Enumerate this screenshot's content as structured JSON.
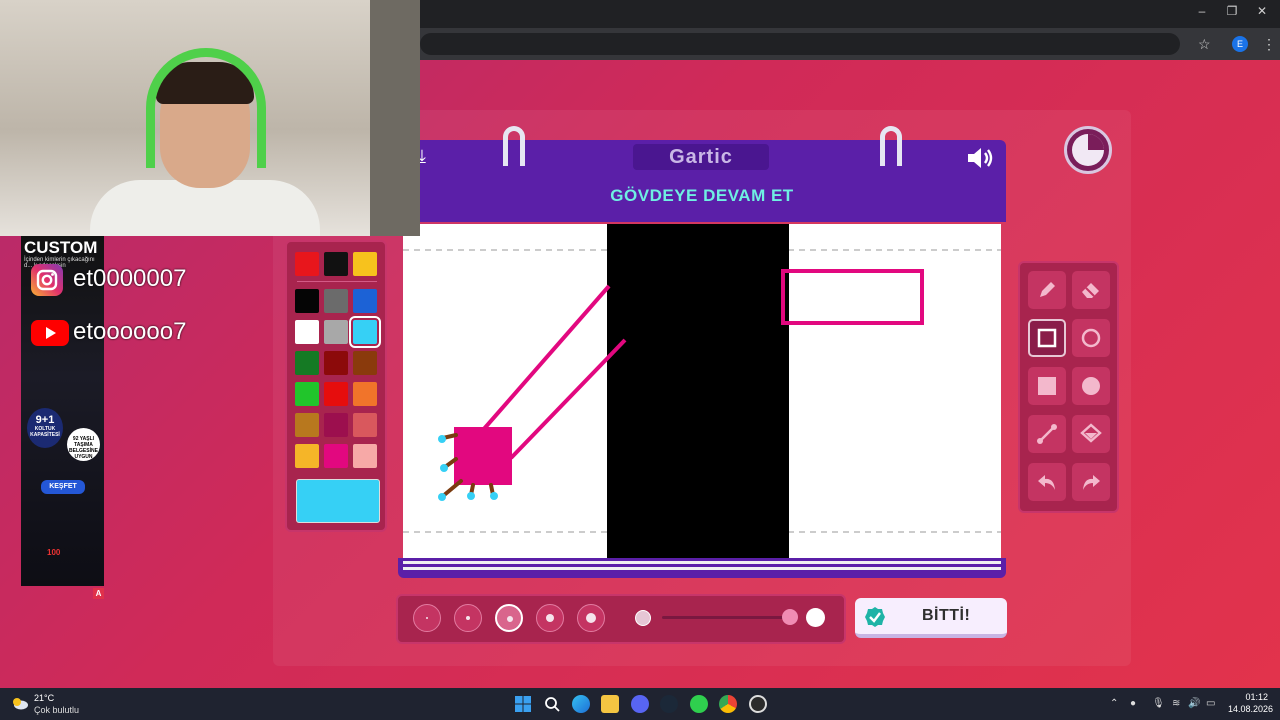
{
  "game": {
    "logo": "Gartic",
    "prompt": "GÖVDEYE DEVAM ET",
    "finish_label": "BİTTİ!"
  },
  "overlay": {
    "instagram": "et0000007",
    "youtube": "etoooooo7"
  },
  "ad": {
    "title": "CUSTOM",
    "subtitle": "İçinden kimlerin çıkacağını d... k edeceksin",
    "badge_line1": "9+1",
    "badge_line2": "KOLTUK KAPASİTESİ",
    "badge2_text": "92 YAŞLI TAŞIMA BELGESİNE UYGUN",
    "cta": "KEŞFET",
    "brand": "100",
    "mark": "A"
  },
  "palette": {
    "colors": [
      "#e8161c",
      "#111111",
      "#f7c21d",
      "#050505",
      "#6b6b6b",
      "#1c62d6",
      "#ffffff",
      "#a8a8a8",
      "#36d0f5",
      "#157a24",
      "#8c0a0a",
      "#8a3a0c",
      "#21c52b",
      "#e60d0d",
      "#f1742a",
      "#b8781e",
      "#9c0f4e",
      "#d9585d",
      "#f5b528",
      "#e2087f",
      "#f7a9a7"
    ],
    "selected_index": 8,
    "selected_color": "#36d0f5"
  },
  "tools": [
    {
      "name": "pencil",
      "selected": false
    },
    {
      "name": "eraser",
      "selected": false
    },
    {
      "name": "rectangle-outline",
      "selected": true
    },
    {
      "name": "circle-outline",
      "selected": false
    },
    {
      "name": "rectangle-filled",
      "selected": false
    },
    {
      "name": "circle-filled",
      "selected": false
    },
    {
      "name": "line",
      "selected": false
    },
    {
      "name": "fill-bucket",
      "selected": false
    },
    {
      "name": "undo",
      "selected": false
    },
    {
      "name": "redo",
      "selected": false
    }
  ],
  "stroke_sizes_selected": 3,
  "opacity_level": 1,
  "taskbar": {
    "temp": "21°C",
    "weather": "Çok bulutlu",
    "time": "01:12",
    "date": "14.08.2026"
  },
  "browser": {
    "profile_initial": "E"
  }
}
